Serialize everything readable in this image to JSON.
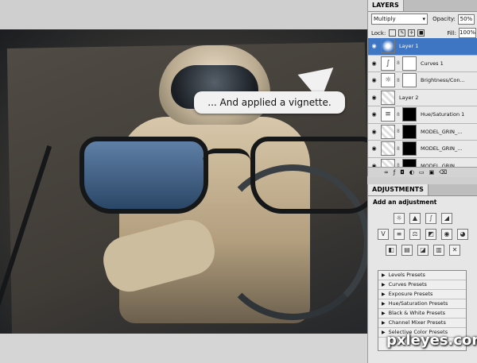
{
  "callout": {
    "text": "... And applied a vignette."
  },
  "layers_panel": {
    "tab": "LAYERS",
    "blend_mode": "Multiply",
    "opacity_label": "Opacity:",
    "opacity_value": "50%",
    "lock_label": "Lock:",
    "fill_label": "Fill:",
    "fill_value": "100%",
    "layers": [
      {
        "name": "Layer 1",
        "selected": true
      },
      {
        "name": "Curves 1"
      },
      {
        "name": "Brightness/Con..."
      },
      {
        "name": "Layer 2"
      },
      {
        "name": "Hue/Saturation 1"
      },
      {
        "name": "MODEL_GRIN_..."
      },
      {
        "name": "MODEL_GRIN_..."
      },
      {
        "name": "MODEL_GRIN..."
      }
    ]
  },
  "adjustments_panel": {
    "tab": "ADJUSTMENTS",
    "title": "Add an adjustment",
    "presets": [
      "Levels Presets",
      "Curves Presets",
      "Exposure Presets",
      "Hue/Saturation Presets",
      "Black & White Presets",
      "Channel Mixer Presets",
      "Selective Color Presets"
    ]
  },
  "watermark": "pxleyes.com",
  "icons": [
    "eye-icon",
    "chain-icon",
    "lock-icon",
    "brush-icon",
    "move-icon",
    "arrow-icon",
    "adjustment-icon"
  ]
}
